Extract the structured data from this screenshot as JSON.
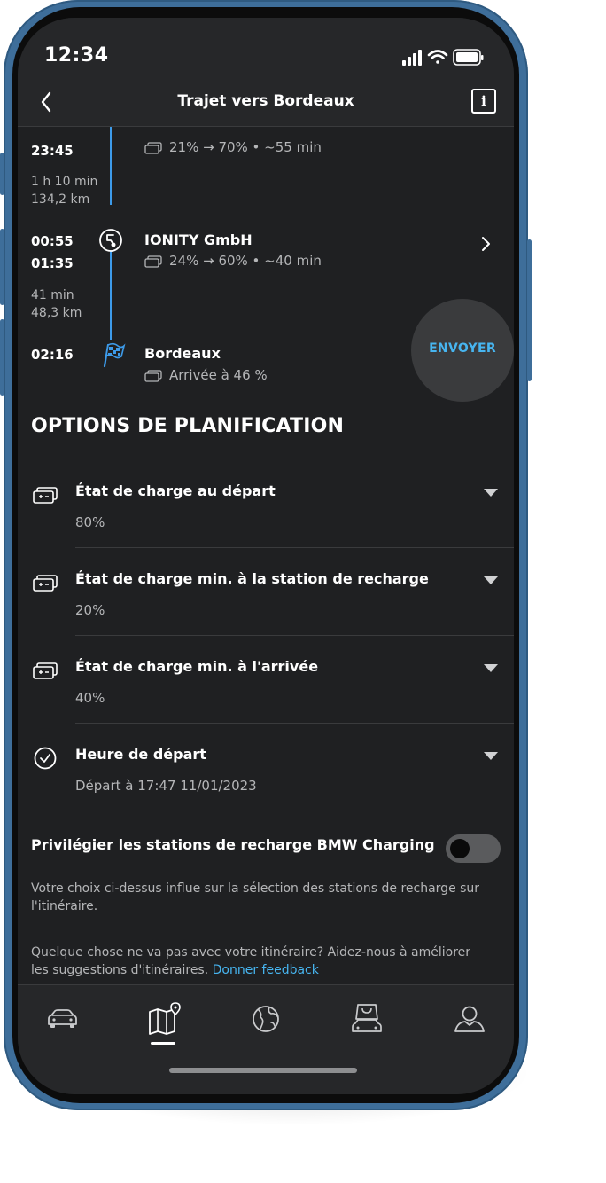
{
  "status_bar": {
    "time": "12:34"
  },
  "header": {
    "title": "Trajet vers Bordeaux",
    "back_icon": "chevron-left-icon",
    "info_icon": "i"
  },
  "route": {
    "segment_top": {
      "time": "23:45",
      "charge": "21% → 70% • ~55 min"
    },
    "leg1": {
      "duration": "1 h 10 min",
      "distance": "134,2 km"
    },
    "stop_ionity": {
      "arrive": "00:55",
      "depart": "01:35",
      "name": "IONITY GmbH",
      "charge": "24% → 60% • ~40 min"
    },
    "leg2": {
      "duration": "41 min",
      "distance": "48,3 km"
    },
    "destination": {
      "time": "02:16",
      "name": "Bordeaux",
      "arrival": "Arrivée à 46 %"
    },
    "send_label": "ENVOYER"
  },
  "planning": {
    "title": "OPTIONS DE PLANIFICATION",
    "options": [
      {
        "label": "État de charge au départ",
        "value": "80%"
      },
      {
        "label": "État de charge min. à la station de recharge",
        "value": "20%"
      },
      {
        "label": "État de charge min. à l'arrivée",
        "value": "40%"
      },
      {
        "label": "Heure de départ",
        "value": "Départ à 17:47 11/01/2023"
      }
    ],
    "toggle": {
      "label": "Privilégier les stations de recharge BMW Charging",
      "on": false
    },
    "note": "Votre choix ci-dessus influe sur la sélection des stations de recharge sur l'itinéraire.",
    "feedback_text": "Quelque chose ne va pas avec votre itinéraire? Aidez-nous à améliorer les suggestions d'itinéraires. ",
    "feedback_link": "Donner feedback"
  },
  "tabs": [
    {
      "name": "car-icon"
    },
    {
      "name": "map-icon",
      "active": true
    },
    {
      "name": "globe-icon"
    },
    {
      "name": "shop-icon"
    },
    {
      "name": "profile-icon"
    }
  ],
  "colors": {
    "accent": "#47b5f0",
    "route_line": "#3d9bea",
    "background": "#1f2022",
    "bar": "#262729"
  }
}
